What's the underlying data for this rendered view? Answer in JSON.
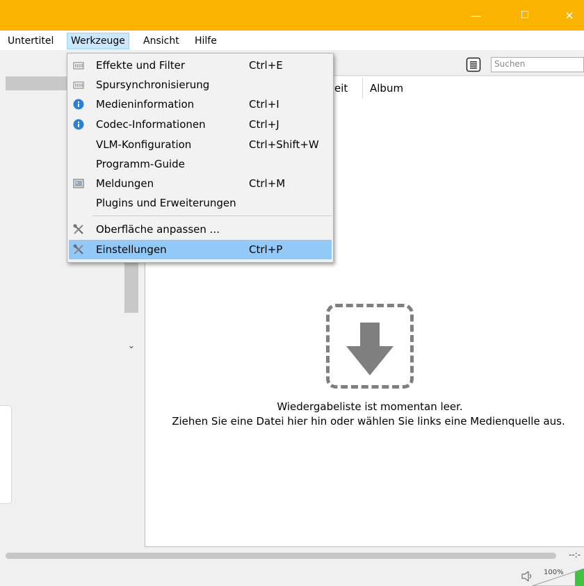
{
  "window": {
    "controls": {
      "minimize": "—",
      "maximize": "☐",
      "close": "✕"
    }
  },
  "menubar": {
    "items": [
      {
        "label": "Untertitel"
      },
      {
        "label": "Werkzeuge"
      },
      {
        "label": "Ansicht"
      },
      {
        "label": "Hilfe"
      }
    ]
  },
  "toolbar": {
    "search": {
      "placeholder": "Suchen"
    }
  },
  "playlist": {
    "columns": {
      "col_partial": "eit",
      "col_album": "Album"
    },
    "empty_message_1": "Wiedergabeliste ist momentan leer.",
    "empty_message_2": "Ziehen Sie eine Datei hier hin oder wählen Sie links eine Medienquelle aus."
  },
  "dropdown": {
    "items": [
      {
        "label": "Effekte und Filter",
        "shortcut": "Ctrl+E",
        "icon": "equalizer-icon"
      },
      {
        "label": "Spursynchronisierung",
        "shortcut": "",
        "icon": "equalizer-icon"
      },
      {
        "label": "Medieninformation",
        "shortcut": "Ctrl+I",
        "icon": "info-icon"
      },
      {
        "label": "Codec-Informationen",
        "shortcut": "Ctrl+J",
        "icon": "info-icon"
      },
      {
        "label": "VLM-Konfiguration",
        "shortcut": "Ctrl+Shift+W",
        "icon": ""
      },
      {
        "label": "Programm-Guide",
        "shortcut": "",
        "icon": ""
      },
      {
        "label": "Meldungen",
        "shortcut": "Ctrl+M",
        "icon": "terminal-icon"
      },
      {
        "label": "Plugins und Erweiterungen",
        "shortcut": "",
        "icon": ""
      },
      {
        "label": "Oberfläche anpassen ...",
        "shortcut": "",
        "icon": "tools-icon"
      },
      {
        "label": "Einstellungen",
        "shortcut": "Ctrl+P",
        "icon": "tools-icon"
      }
    ]
  },
  "status": {
    "time": "--:-",
    "volume": "100%"
  },
  "colors": {
    "accent": "#fbb200",
    "highlight": "#92c9f7",
    "volume_green": "#3ec43e"
  }
}
